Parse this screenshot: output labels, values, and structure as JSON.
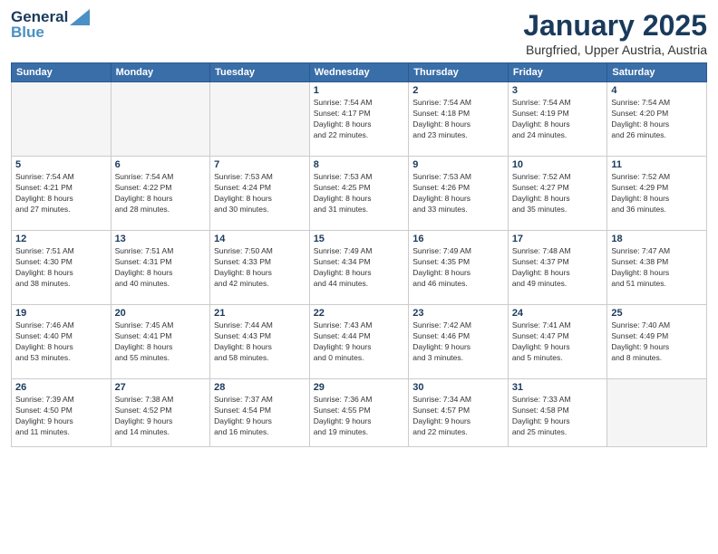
{
  "logo": {
    "line1": "General",
    "line2": "Blue"
  },
  "title": "January 2025",
  "location": "Burgfried, Upper Austria, Austria",
  "days_header": [
    "Sunday",
    "Monday",
    "Tuesday",
    "Wednesday",
    "Thursday",
    "Friday",
    "Saturday"
  ],
  "weeks": [
    [
      {
        "day": "",
        "info": ""
      },
      {
        "day": "",
        "info": ""
      },
      {
        "day": "",
        "info": ""
      },
      {
        "day": "1",
        "info": "Sunrise: 7:54 AM\nSunset: 4:17 PM\nDaylight: 8 hours\nand 22 minutes."
      },
      {
        "day": "2",
        "info": "Sunrise: 7:54 AM\nSunset: 4:18 PM\nDaylight: 8 hours\nand 23 minutes."
      },
      {
        "day": "3",
        "info": "Sunrise: 7:54 AM\nSunset: 4:19 PM\nDaylight: 8 hours\nand 24 minutes."
      },
      {
        "day": "4",
        "info": "Sunrise: 7:54 AM\nSunset: 4:20 PM\nDaylight: 8 hours\nand 26 minutes."
      }
    ],
    [
      {
        "day": "5",
        "info": "Sunrise: 7:54 AM\nSunset: 4:21 PM\nDaylight: 8 hours\nand 27 minutes."
      },
      {
        "day": "6",
        "info": "Sunrise: 7:54 AM\nSunset: 4:22 PM\nDaylight: 8 hours\nand 28 minutes."
      },
      {
        "day": "7",
        "info": "Sunrise: 7:53 AM\nSunset: 4:24 PM\nDaylight: 8 hours\nand 30 minutes."
      },
      {
        "day": "8",
        "info": "Sunrise: 7:53 AM\nSunset: 4:25 PM\nDaylight: 8 hours\nand 31 minutes."
      },
      {
        "day": "9",
        "info": "Sunrise: 7:53 AM\nSunset: 4:26 PM\nDaylight: 8 hours\nand 33 minutes."
      },
      {
        "day": "10",
        "info": "Sunrise: 7:52 AM\nSunset: 4:27 PM\nDaylight: 8 hours\nand 35 minutes."
      },
      {
        "day": "11",
        "info": "Sunrise: 7:52 AM\nSunset: 4:29 PM\nDaylight: 8 hours\nand 36 minutes."
      }
    ],
    [
      {
        "day": "12",
        "info": "Sunrise: 7:51 AM\nSunset: 4:30 PM\nDaylight: 8 hours\nand 38 minutes."
      },
      {
        "day": "13",
        "info": "Sunrise: 7:51 AM\nSunset: 4:31 PM\nDaylight: 8 hours\nand 40 minutes."
      },
      {
        "day": "14",
        "info": "Sunrise: 7:50 AM\nSunset: 4:33 PM\nDaylight: 8 hours\nand 42 minutes."
      },
      {
        "day": "15",
        "info": "Sunrise: 7:49 AM\nSunset: 4:34 PM\nDaylight: 8 hours\nand 44 minutes."
      },
      {
        "day": "16",
        "info": "Sunrise: 7:49 AM\nSunset: 4:35 PM\nDaylight: 8 hours\nand 46 minutes."
      },
      {
        "day": "17",
        "info": "Sunrise: 7:48 AM\nSunset: 4:37 PM\nDaylight: 8 hours\nand 49 minutes."
      },
      {
        "day": "18",
        "info": "Sunrise: 7:47 AM\nSunset: 4:38 PM\nDaylight: 8 hours\nand 51 minutes."
      }
    ],
    [
      {
        "day": "19",
        "info": "Sunrise: 7:46 AM\nSunset: 4:40 PM\nDaylight: 8 hours\nand 53 minutes."
      },
      {
        "day": "20",
        "info": "Sunrise: 7:45 AM\nSunset: 4:41 PM\nDaylight: 8 hours\nand 55 minutes."
      },
      {
        "day": "21",
        "info": "Sunrise: 7:44 AM\nSunset: 4:43 PM\nDaylight: 8 hours\nand 58 minutes."
      },
      {
        "day": "22",
        "info": "Sunrise: 7:43 AM\nSunset: 4:44 PM\nDaylight: 9 hours\nand 0 minutes."
      },
      {
        "day": "23",
        "info": "Sunrise: 7:42 AM\nSunset: 4:46 PM\nDaylight: 9 hours\nand 3 minutes."
      },
      {
        "day": "24",
        "info": "Sunrise: 7:41 AM\nSunset: 4:47 PM\nDaylight: 9 hours\nand 5 minutes."
      },
      {
        "day": "25",
        "info": "Sunrise: 7:40 AM\nSunset: 4:49 PM\nDaylight: 9 hours\nand 8 minutes."
      }
    ],
    [
      {
        "day": "26",
        "info": "Sunrise: 7:39 AM\nSunset: 4:50 PM\nDaylight: 9 hours\nand 11 minutes."
      },
      {
        "day": "27",
        "info": "Sunrise: 7:38 AM\nSunset: 4:52 PM\nDaylight: 9 hours\nand 14 minutes."
      },
      {
        "day": "28",
        "info": "Sunrise: 7:37 AM\nSunset: 4:54 PM\nDaylight: 9 hours\nand 16 minutes."
      },
      {
        "day": "29",
        "info": "Sunrise: 7:36 AM\nSunset: 4:55 PM\nDaylight: 9 hours\nand 19 minutes."
      },
      {
        "day": "30",
        "info": "Sunrise: 7:34 AM\nSunset: 4:57 PM\nDaylight: 9 hours\nand 22 minutes."
      },
      {
        "day": "31",
        "info": "Sunrise: 7:33 AM\nSunset: 4:58 PM\nDaylight: 9 hours\nand 25 minutes."
      },
      {
        "day": "",
        "info": ""
      }
    ]
  ]
}
